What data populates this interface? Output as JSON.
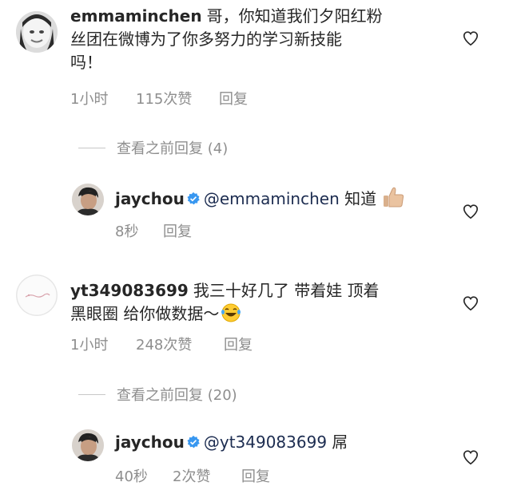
{
  "comments": [
    {
      "username": "emmaminchen",
      "text_line1": "哥，你知道我们夕阳红粉",
      "text_line2": "丝团在微博为了你多努力的学习新技能",
      "text_line3": "吗！",
      "time": "1小时",
      "likes": "115次赞",
      "reply": "回复"
    },
    {
      "view_replies": "查看之前回复 (4)"
    },
    {
      "username": "jaychou",
      "mention": "@emmaminchen",
      "text": "知道",
      "time": "8秒",
      "reply": "回复"
    },
    {
      "username": "yt349083699",
      "text_line1": "我三十好几了 带着娃 顶着",
      "text_line2": "黑眼圈 给你做数据～",
      "time": "1小时",
      "likes": "248次赞",
      "reply": "回复"
    },
    {
      "view_replies": "查看之前回复 (20)"
    },
    {
      "username": "jaychou",
      "mention": "@yt349083699",
      "text": "屌",
      "time": "40秒",
      "likes": "2次赞",
      "reply": "回复"
    }
  ],
  "colors": {
    "text": "#262626",
    "meta": "#8e8e8e",
    "verified": "#3897f0"
  },
  "icons": [
    "heart-outline-icon",
    "verified-badge-icon",
    "thumbs-up-emoji",
    "laughing-tears-emoji"
  ]
}
